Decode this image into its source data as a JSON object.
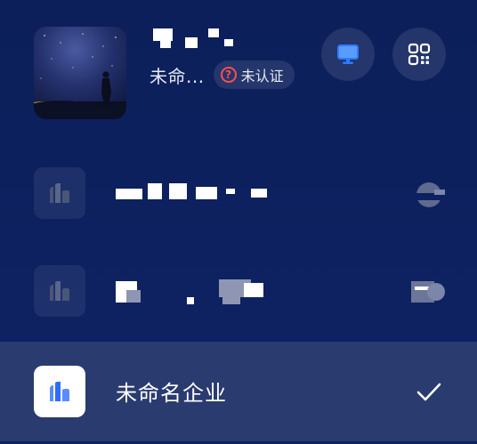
{
  "profile": {
    "company_short": "未命...",
    "verify_badge": "未认证",
    "avatar_icon": "night-sky-person-photo",
    "actions": {
      "desktop_icon": "monitor-icon",
      "qr_icon": "qr-code-icon"
    }
  },
  "enterprises": [
    {
      "logo_icon": "enterprise-logo-icon",
      "selected": false
    },
    {
      "logo_icon": "enterprise-logo-icon",
      "selected": false
    },
    {
      "name": "未命名企业",
      "logo_icon": "enterprise-logo-icon",
      "selected": true,
      "check_icon": "check-icon"
    }
  ],
  "colors": {
    "background": "#0c1f5a",
    "selected_row": "#2a3b70",
    "accent_blue": "#2f6bff",
    "badge_red": "#ff4d4f"
  }
}
